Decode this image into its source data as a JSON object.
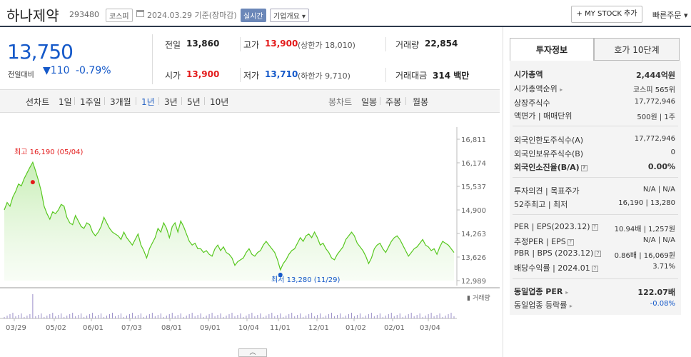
{
  "header": {
    "company_name": "하나제약",
    "stock_code": "293480",
    "market": "코스피",
    "as_of": "2024.03.29  기준(장마감)",
    "realtime_label": "실시간",
    "overview_label": "기업개요",
    "mystock_label": "+ MY STOCK 추가",
    "quick_order_label": "빠른주문"
  },
  "quote": {
    "current_price": "13,750",
    "change_label": "전일대비",
    "change_value": "110",
    "change_pct": "-0.79%",
    "prev_close_label": "전일",
    "prev_close": "13,860",
    "high_label": "고가",
    "high": "13,900",
    "upper_limit_label": "(상한가",
    "upper_limit": "18,010)",
    "volume_label": "거래량",
    "volume": "22,854",
    "open_label": "시가",
    "open": "13,900",
    "low_label": "저가",
    "low": "13,710",
    "lower_limit_label": "(하한가",
    "lower_limit": "9,710)",
    "trade_value_label": "거래대금",
    "trade_value": "314",
    "trade_value_unit": "백만"
  },
  "period_bar": {
    "line_chart_label": "선차트",
    "periods": [
      "1일",
      "1주일",
      "3개월",
      "1년",
      "3년",
      "5년",
      "10년"
    ],
    "active_period": "1년",
    "candle_label": "봉차트",
    "candle_periods": [
      "일봉",
      "주봉",
      "월봉"
    ]
  },
  "chart_data": {
    "type": "area",
    "y_ticks": [
      "16,811",
      "16,174",
      "15,537",
      "14,900",
      "14,263",
      "13,626",
      "12,989"
    ],
    "ylim": [
      12989,
      16811
    ],
    "x_ticks": [
      "03/29",
      "05/02",
      "06/01",
      "07/03",
      "08/01",
      "09/01",
      "10/04",
      "11/01",
      "12/01",
      "01/02",
      "02/01",
      "03/04"
    ],
    "high_annotation": "최고 16,190 (05/04)",
    "low_annotation": "최저 13,280 (11/29)",
    "volume_label": "거래량",
    "values": [
      14900,
      15100,
      15000,
      15250,
      15400,
      15600,
      15550,
      15750,
      15900,
      16050,
      16190,
      15950,
      15700,
      15400,
      15000,
      14800,
      14650,
      14850,
      14800,
      14900,
      15050,
      15000,
      14700,
      14550,
      14500,
      14750,
      14600,
      14450,
      14400,
      14550,
      14500,
      14300,
      14200,
      14300,
      14450,
      14700,
      14550,
      14400,
      14300,
      14250,
      14200,
      14100,
      14300,
      14150,
      14050,
      13950,
      14100,
      14250,
      13950,
      13800,
      13600,
      13850,
      14000,
      14150,
      14400,
      14300,
      14550,
      14400,
      14150,
      14450,
      14550,
      14300,
      14600,
      14450,
      14250,
      14050,
      13950,
      14000,
      13850,
      13850,
      13750,
      13800,
      13700,
      13650,
      13850,
      13950,
      13800,
      13900,
      13750,
      13700,
      13600,
      13400,
      13500,
      13550,
      13600,
      13750,
      13850,
      13700,
      13650,
      13750,
      13800,
      13950,
      14050,
      13950,
      13850,
      13750,
      13550,
      13280,
      13450,
      13550,
      13700,
      13800,
      13850,
      14000,
      14150,
      14050,
      14200,
      14250,
      14150,
      14300,
      14150,
      13950,
      14000,
      13850,
      13750,
      13600,
      13550,
      13700,
      13800,
      13900,
      14100,
      14200,
      14300,
      14200,
      14000,
      13900,
      13800,
      13650,
      13450,
      13600,
      13850,
      13950,
      14000,
      13850,
      13750,
      13900,
      14050,
      14150,
      14200,
      14100,
      13950,
      13800,
      13650,
      13750,
      13850,
      13900,
      14000,
      14100,
      13950,
      13900,
      13800,
      13850,
      13700,
      13900,
      14050,
      14000,
      13950,
      13850,
      13750
    ]
  },
  "sidebar": {
    "tab_invest": "투자정보",
    "tab_orderbook": "호가 10단계",
    "rows": [
      {
        "label": "시가총액",
        "value": "2,444억원"
      },
      {
        "label": "시가총액순위",
        "value": "코스피 565위"
      },
      {
        "label": "상장주식수",
        "value": "17,772,946"
      },
      {
        "label": "액면가 | 매매단위",
        "value": "500원 | 1주"
      },
      {
        "label": "외국인한도주식수(A)",
        "value": "17,772,946"
      },
      {
        "label": "외국인보유주식수(B)",
        "value": "0"
      },
      {
        "label": "외국인소진율(B/A)",
        "value": "0.00%"
      },
      {
        "label": "투자의견 | 목표주가",
        "value": "N/A | N/A"
      },
      {
        "label": "52주최고 | 최저",
        "value": "16,190 | 13,280"
      },
      {
        "label": "PER | EPS(2023.12)",
        "value": "10.94배 | 1,257원"
      },
      {
        "label": "추정PER | EPS",
        "value": "N/A | N/A"
      },
      {
        "label": "PBR | BPS (2023.12)",
        "value": "0.86배 | 16,069원"
      },
      {
        "label": "배당수익률 | 2024.01",
        "value": "3.71%"
      },
      {
        "label": "동일업종 PER",
        "value": "122.07배"
      },
      {
        "label": "동일업종 등락률",
        "value": "-0.08%"
      }
    ]
  }
}
